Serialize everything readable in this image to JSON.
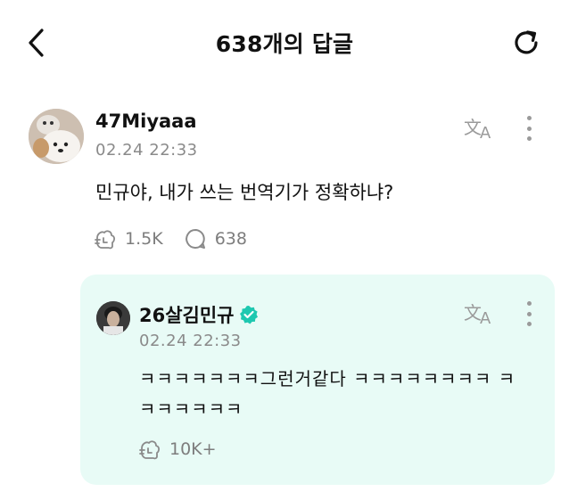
{
  "header": {
    "title": "638개의 답글",
    "back_icon": "chevron-left-icon",
    "refresh_icon": "refresh-icon"
  },
  "comment": {
    "username": "47Miyaaa",
    "timestamp": "02.24 22:33",
    "text": "민규야, 내가 쓰는 번역기가 정확하냐?",
    "likes": "1.5K",
    "replies": "638",
    "translate_icon": "translate-icon",
    "more_icon": "more-vertical-icon"
  },
  "reply": {
    "username": "26살김민규",
    "verified": true,
    "timestamp": "02.24 22:33",
    "text": "ㅋㅋㅋㅋㅋㅋㅋ그런거같다 ㅋㅋㅋㅋㅋㅋㅋㅋ ㅋㅋㅋㅋㅋㅋㅋ",
    "likes": "10K+",
    "background_color": "#e8fbf6",
    "verified_color": "#1ec8b0"
  }
}
